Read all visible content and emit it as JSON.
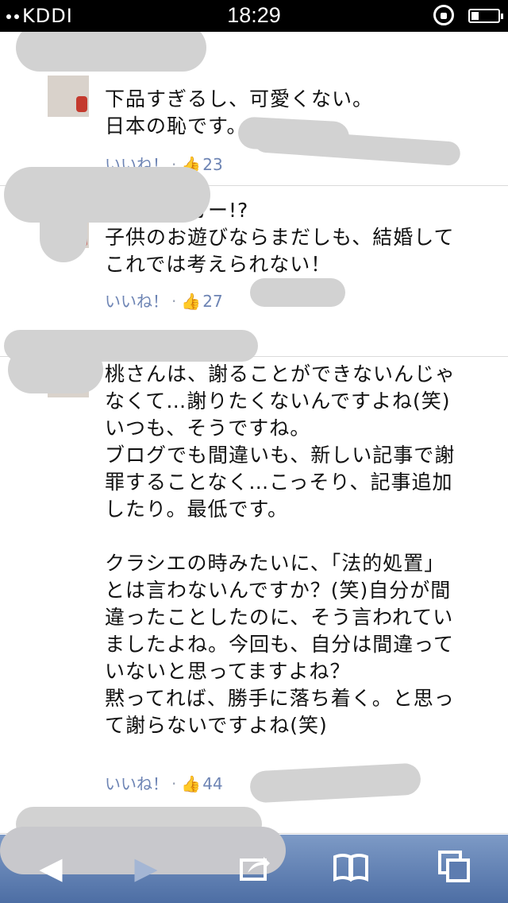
{
  "status": {
    "carrier": "KDDI",
    "time": "18:29"
  },
  "comments": [
    {
      "lines": "下品すぎるし、可愛くない。\n日本の恥です。",
      "like": "いいね！",
      "dot": "·",
      "count": "23"
    },
    {
      "lines": "人気ブロガー!?\n子供のお遊びならまだしも、結婚して\nこれでは考えられない！",
      "like": "いいね！",
      "dot": "·",
      "count": "27"
    },
    {
      "lines": "桃さんは、謝ることができないんじゃ\nなくて…謝りたくないんですよね(笑)\nいつも、そうですね。\nブログでも間違いも、新しい記事で謝\n罪することなく…こっそり、記事追加\nしたり。最低です。\n\nクラシエの時みたいに、「法的処置」\nとは言わないんですか？(笑)自分が間\n違ったことしたのに、そう言われてい\nましたよね。今回も、自分は間違って\nいないと思ってますよね？\n黙ってれば、勝手に落ち着く。と思っ\nて謝らないですよね(笑)",
      "like": "いいね！",
      "dot": "·",
      "count": "44"
    }
  ],
  "toolbar": {
    "icons": [
      "back-icon",
      "forward-icon",
      "share-icon",
      "bookmarks-icon",
      "tabs-icon"
    ]
  },
  "colors": {
    "link": "#6d84b4",
    "toolbar": "#5d7cb0"
  }
}
